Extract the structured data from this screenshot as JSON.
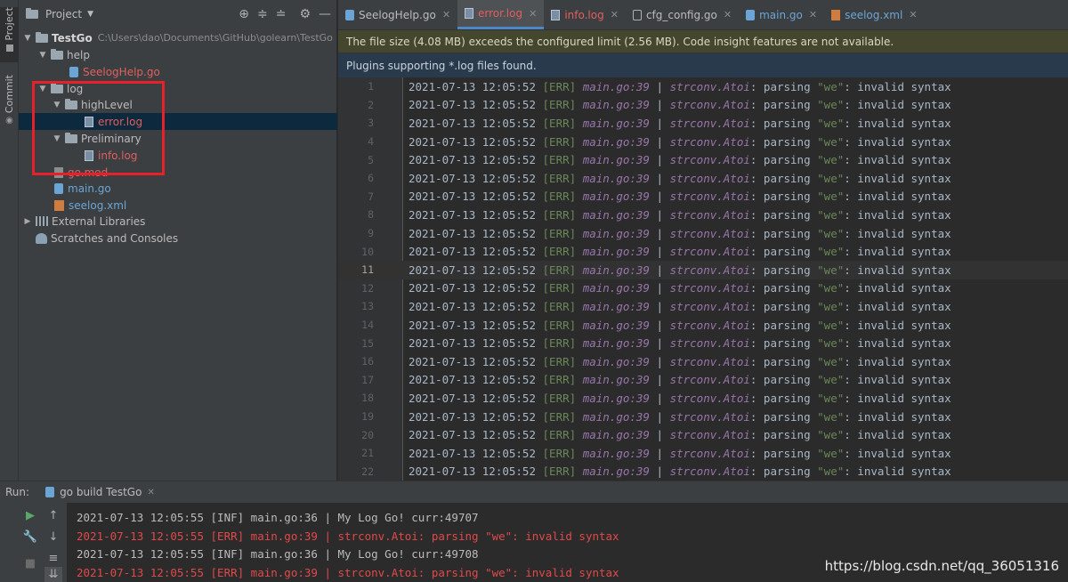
{
  "tool_strip": {
    "project_label": "Project",
    "commit_label": "Commit"
  },
  "project_panel": {
    "title": "Project",
    "tree": [
      {
        "label": "TestGo",
        "path": "C:\\Users\\dao\\Documents\\GitHub\\golearn\\TestGo",
        "type": "root"
      },
      {
        "label": "help",
        "type": "folder"
      },
      {
        "label": "SeelogHelp.go",
        "type": "go"
      },
      {
        "label": "log",
        "type": "folder"
      },
      {
        "label": "highLevel",
        "type": "folder"
      },
      {
        "label": "error.log",
        "type": "log"
      },
      {
        "label": "Preliminary",
        "type": "folder"
      },
      {
        "label": "info.log",
        "type": "log"
      },
      {
        "label": "go.mod",
        "type": "mod"
      },
      {
        "label": "main.go",
        "type": "go"
      },
      {
        "label": "seelog.xml",
        "type": "xml"
      },
      {
        "label": "External Libraries",
        "type": "lib"
      },
      {
        "label": "Scratches and Consoles",
        "type": "scratch"
      }
    ]
  },
  "tabs": [
    {
      "label": "SeelogHelp.go",
      "icon": "go-file-icon"
    },
    {
      "label": "error.log",
      "icon": "log-file-icon"
    },
    {
      "label": "info.log",
      "icon": "log-file-icon"
    },
    {
      "label": "cfg_config.go",
      "icon": "config-file-icon"
    },
    {
      "label": "main.go",
      "icon": "go-file-icon"
    },
    {
      "label": "seelog.xml",
      "icon": "xml-file-icon"
    }
  ],
  "banners": {
    "warning": "The file size (4.08 MB) exceeds the configured limit (2.56 MB). Code insight features are not available.",
    "plugins": "Plugins supporting *.log files found."
  },
  "editor": {
    "current_line": 11,
    "lines": {
      "timestamp": "2021-07-13 12:05:52",
      "level": "[ERR]",
      "source": "main.go:39",
      "sep": "|",
      "func": "strconv.Atoi",
      "msg1": ": parsing ",
      "quoted": "\"we\"",
      "msg2": ": invalid syntax"
    },
    "line_numbers": [
      "1",
      "2",
      "3",
      "4",
      "5",
      "6",
      "7",
      "8",
      "9",
      "10",
      "11",
      "12",
      "13",
      "14",
      "15",
      "16",
      "17",
      "18",
      "19",
      "20",
      "21",
      "22"
    ]
  },
  "run_panel": {
    "title": "Run:",
    "tab_label": "go build TestGo",
    "console": [
      {
        "level": "inf",
        "text": "2021-07-13 12:05:55 [INF] main.go:36 | My Log Go! curr:49707"
      },
      {
        "level": "err",
        "text": "2021-07-13 12:05:55 [ERR] main.go:39 | strconv.Atoi: parsing \"we\": invalid syntax"
      },
      {
        "level": "inf",
        "text": "2021-07-13 12:05:55 [INF] main.go:36 | My Log Go! curr:49708"
      },
      {
        "level": "err",
        "text": "2021-07-13 12:05:55 [ERR] main.go:39 | strconv.Atoi: parsing \"we\": invalid syntax"
      }
    ]
  },
  "watermark": "https://blog.csdn.net/qq_36051316"
}
